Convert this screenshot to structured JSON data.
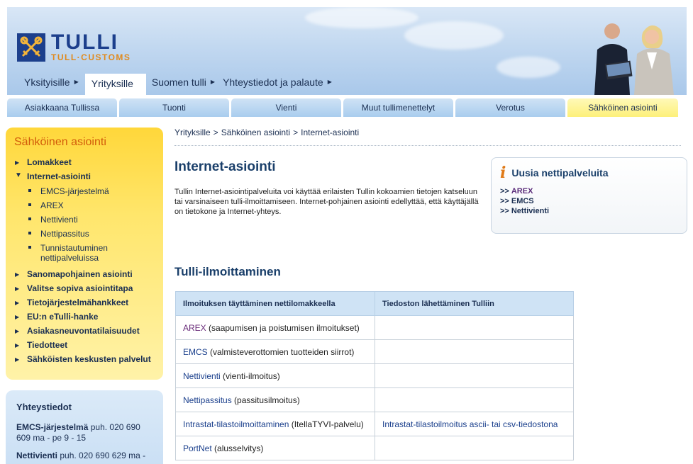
{
  "logo": {
    "name": "TULLI",
    "subtitle": "TULL·CUSTOMS"
  },
  "topnav": [
    {
      "label": "Yksityisille",
      "active": false
    },
    {
      "label": "Yrityksille",
      "active": true
    },
    {
      "label": "Suomen tulli",
      "active": false
    },
    {
      "label": "Yhteystiedot ja palaute",
      "active": false
    }
  ],
  "tabs": [
    {
      "label": "Asiakkaana Tullissa",
      "active": false
    },
    {
      "label": "Tuonti",
      "active": false
    },
    {
      "label": "Vienti",
      "active": false
    },
    {
      "label": "Muut tullimenettelyt",
      "active": false
    },
    {
      "label": "Verotus",
      "active": false
    },
    {
      "label": "Sähköinen asiointi",
      "active": true
    }
  ],
  "sidebar": {
    "title": "Sähköinen asiointi",
    "items": [
      {
        "label": "Lomakkeet",
        "expanded": false
      },
      {
        "label": "Internet-asiointi",
        "expanded": true,
        "children": [
          "EMCS-järjestelmä",
          "AREX",
          "Nettivienti",
          "Nettipassitus",
          "Tunnistautuminen nettipalveluissa"
        ]
      },
      {
        "label": "Sanomapohjainen asiointi",
        "expanded": false
      },
      {
        "label": "Valitse sopiva asiointitapa",
        "expanded": false
      },
      {
        "label": "Tietojärjestelmähankkeet",
        "expanded": false
      },
      {
        "label": "EU:n eTulli-hanke",
        "expanded": false
      },
      {
        "label": "Asiakasneuvontatilaisuudet",
        "expanded": false
      },
      {
        "label": "Tiedotteet",
        "expanded": false
      },
      {
        "label": "Sähköisten keskusten palvelut",
        "expanded": false
      }
    ]
  },
  "contact": {
    "title": "Yhteystiedot",
    "entries": [
      {
        "name": "EMCS-järjestelmä",
        "info": "puh. 020 690 609 ma - pe 9 - 15"
      },
      {
        "name": "Nettivienti",
        "info": "puh. 020 690 629 ma -"
      }
    ]
  },
  "breadcrumb": [
    "Yrityksille",
    "Sähköinen asiointi",
    "Internet-asiointi"
  ],
  "breadcrumb_sep": ">",
  "main": {
    "title": "Internet-asiointi",
    "intro": "Tullin Internet-asiointipalveluita voi käyttää erilaisten Tullin kokoamien tietojen katseluun tai varsinaiseen tulli-ilmoittamiseen. Internet-pohjainen asiointi edellyttää, että käyttäjällä on tietokone ja Internet-yhteys.",
    "section_title": "Tulli-ilmoittaminen"
  },
  "infobox": {
    "icon": "info-icon",
    "title": "Uusia nettipalveluita",
    "prefix": ">>",
    "links": [
      {
        "label": "AREX",
        "visited": true
      },
      {
        "label": "EMCS",
        "visited": false
      },
      {
        "label": "Nettivienti",
        "visited": false
      }
    ]
  },
  "table": {
    "headers": [
      "Ilmoituksen täyttäminen nettilomakkeella",
      "Tiedoston lähettäminen Tulliin"
    ],
    "rows": [
      {
        "link": "AREX",
        "rest": " (saapumisen ja poistumisen ilmoitukset)",
        "visited": true,
        "col2": ""
      },
      {
        "link": "EMCS",
        "rest": " (valmisteverottomien tuotteiden siirrot)",
        "visited": false,
        "col2": ""
      },
      {
        "link": "Nettivienti",
        "rest": " (vienti-ilmoitus)",
        "visited": false,
        "col2": ""
      },
      {
        "link": "Nettipassitus",
        "rest": " (passitusilmoitus)",
        "visited": false,
        "col2": ""
      },
      {
        "link": "Intrastat-tilastoilmoittaminen",
        "rest": " (ItellaTYVI-palvelu)",
        "visited": false,
        "col2": "Intrastat-tilastoilmoitus ascii- tai csv-tiedostona"
      },
      {
        "link": "PortNet",
        "rest": " (alusselvitys)",
        "visited": false,
        "col2": ""
      }
    ]
  },
  "colors": {
    "navy": "#1b2f52",
    "orange": "#d25b0a",
    "yellow": "#ffd73a",
    "visited": "#6a2c7a"
  }
}
